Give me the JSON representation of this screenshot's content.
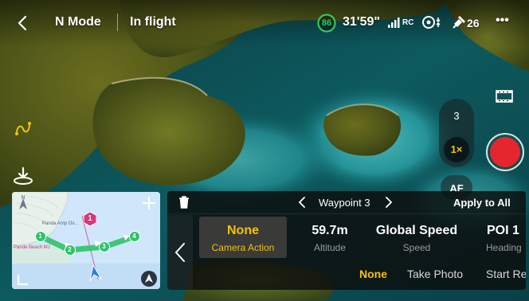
{
  "topbar": {
    "mode": "N Mode",
    "flight_status": "In flight",
    "battery_percent": "86",
    "flight_time": "31'59\"",
    "rc_label": "RC",
    "satellite_count": "26",
    "more_label": "•••"
  },
  "zoom": {
    "level_top": "3",
    "level_current": "1×",
    "af_label": "AF"
  },
  "minimap": {
    "place_label_1": "Panda Amp Ov...",
    "place_label_2": "Pande Beach MJ",
    "poi_label": "1",
    "waypoints": [
      "1",
      "2",
      "3",
      "4"
    ]
  },
  "waypoint_panel": {
    "current_waypoint": "Waypoint 3",
    "apply_all": "Apply to All",
    "params": [
      {
        "value": "None",
        "label": "Camera Action"
      },
      {
        "value": "59.7m",
        "label": "Altitude"
      },
      {
        "value": "Global Speed",
        "label": "Speed"
      },
      {
        "value": "POI 1",
        "label": "Heading"
      }
    ],
    "action_options": [
      "None",
      "Take Photo",
      "Start Re"
    ]
  },
  "colors": {
    "accent_yellow": "#f4c20d",
    "record_red": "#e5262c",
    "route_green": "#2fc36a",
    "battery_green": "#34c759",
    "poi_magenta": "#e0337a"
  }
}
